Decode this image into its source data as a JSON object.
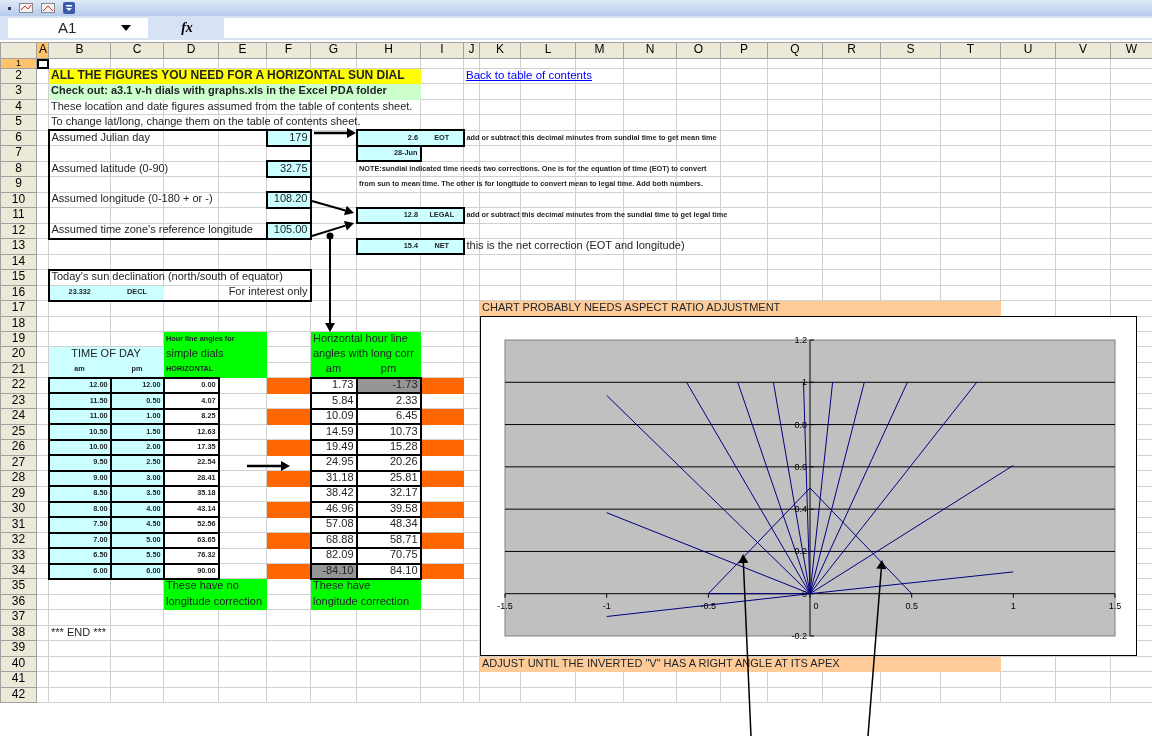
{
  "formula_bar": {
    "name_box": "A1",
    "function_label": "fx"
  },
  "columns": [
    {
      "label": "A",
      "selected": true
    },
    {
      "label": "B",
      "selected": false
    },
    {
      "label": "C",
      "selected": false
    },
    {
      "label": "D",
      "selected": false
    },
    {
      "label": "E",
      "selected": false
    },
    {
      "label": "F",
      "selected": false
    },
    {
      "label": "G",
      "selected": false
    },
    {
      "label": "H",
      "selected": false
    },
    {
      "label": "I",
      "selected": false
    },
    {
      "label": "J",
      "selected": false
    },
    {
      "label": "K",
      "selected": false
    },
    {
      "label": "L",
      "selected": false
    },
    {
      "label": "M",
      "selected": false
    },
    {
      "label": "N",
      "selected": false
    },
    {
      "label": "O",
      "selected": false
    },
    {
      "label": "P",
      "selected": false
    },
    {
      "label": "Q",
      "selected": false
    },
    {
      "label": "R",
      "selected": false
    },
    {
      "label": "S",
      "selected": false
    },
    {
      "label": "T",
      "selected": false
    },
    {
      "label": "U",
      "selected": false
    },
    {
      "label": "V",
      "selected": false
    },
    {
      "label": "W",
      "selected": false
    }
  ],
  "rows": [
    {
      "number": "1",
      "selected": true
    },
    {
      "number": "2",
      "selected": false,
      "cells": {
        "B": {
          "kind": "heading",
          "text": "ALL THE FIGURES YOU NEED FOR A HORIZONTAL SUN DIAL",
          "color": "#ffff00"
        },
        "C": {
          "color": "#ffff00"
        },
        "D": {
          "color": "#ffff00"
        },
        "E": {
          "color": "#ffff00"
        },
        "F": {
          "color": "#ffff00"
        },
        "G": {
          "color": "#ffff00"
        },
        "H": {
          "color": "#ffff00"
        },
        "J": {
          "kind": "link",
          "text": "Back to table of contents"
        }
      }
    },
    {
      "number": "3",
      "selected": false,
      "cells": {
        "B": {
          "kind": "subheading",
          "text": "Check out: a3.1 v-h dials with graphs.xls in the Excel PDA folder",
          "color": "#ccffcc"
        },
        "C": {
          "color": "#ccffcc"
        },
        "D": {
          "color": "#ccffcc"
        },
        "E": {
          "color": "#ccffcc"
        },
        "F": {
          "color": "#ccffcc"
        },
        "G": {
          "color": "#ccffcc"
        },
        "H": {
          "color": "#ccffcc"
        }
      }
    },
    {
      "number": "4",
      "selected": false,
      "cells": {
        "B": {
          "kind": "text",
          "text": "These location and date figures assumed from the table of contents sheet."
        }
      }
    },
    {
      "number": "5",
      "selected": false,
      "cells": {
        "B": {
          "kind": "text",
          "text": "To change lat/long, change them on the table of contents sheet."
        }
      }
    },
    {
      "number": "6",
      "selected": false,
      "cells": {
        "B": {
          "kind": "text",
          "text": "Assumed Julian day"
        },
        "F": {
          "kind": "number",
          "text": "179",
          "color": "#ccffff"
        },
        "H": {
          "kind": "code",
          "text": "2.6",
          "color": "#ccffff"
        },
        "I": {
          "kind": "tag",
          "text": "EOT",
          "color": "#ccffff"
        },
        "J": {
          "kind": "note",
          "text": "add or subtract this decimal minutes from sundial time to get mean time"
        }
      }
    },
    {
      "number": "7",
      "selected": false,
      "cells": {
        "H": {
          "kind": "code",
          "text": "28-Jun",
          "color": "#ccffff"
        }
      }
    },
    {
      "number": "8",
      "selected": false,
      "cells": {
        "B": {
          "kind": "text",
          "text": "Assumed latitude (0-90)"
        },
        "F": {
          "kind": "number",
          "text": "32.75",
          "color": "#ccffff"
        },
        "H": {
          "kind": "note",
          "text": "NOTE:sundial indicated time needs two corrections. One is for the equation of time (EOT) to convert"
        }
      }
    },
    {
      "number": "9",
      "selected": false,
      "cells": {
        "H": {
          "kind": "note",
          "text": "from sun to mean time. The other is for longitude to convert mean to legal time. Add both numbers."
        }
      }
    },
    {
      "number": "10",
      "selected": false,
      "cells": {
        "B": {
          "kind": "text",
          "text": "Assumed longitude (0-180 + or -)"
        },
        "F": {
          "kind": "number",
          "text": "108.20",
          "color": "#ccffff"
        }
      }
    },
    {
      "number": "11",
      "selected": false,
      "cells": {
        "H": {
          "kind": "code",
          "text": "12.8",
          "color": "#ccffff"
        },
        "I": {
          "kind": "tag",
          "text": "LEGAL",
          "color": "#ccffff"
        },
        "J": {
          "kind": "note",
          "text": "add or subtract this decimal minutes from the sundial time to get legal time"
        }
      }
    },
    {
      "number": "12",
      "selected": false,
      "cells": {
        "B": {
          "kind": "text",
          "text": "Assumed time zone's reference longitude"
        },
        "F": {
          "kind": "number",
          "text": "105.00",
          "color": "#ccffff"
        }
      }
    },
    {
      "number": "13",
      "selected": false,
      "cells": {
        "H": {
          "kind": "code",
          "text": "15.4",
          "color": "#ccffff"
        },
        "I": {
          "kind": "tag",
          "text": "NET",
          "color": "#ccffff"
        },
        "J": {
          "kind": "text",
          "text": "this is the net correction (EOT and longitude)"
        }
      }
    },
    {
      "number": "14",
      "selected": false
    },
    {
      "number": "15",
      "selected": false,
      "cells": {
        "B": {
          "kind": "text",
          "text": "Today's sun declination (north/south of equator)"
        }
      }
    },
    {
      "number": "16",
      "selected": false,
      "cells": {
        "B": {
          "kind": "tag",
          "text": "23.332",
          "color": "#ccffff"
        },
        "C": {
          "kind": "tag",
          "text": "DECL",
          "color": "#ccffff"
        },
        "F": {
          "kind": "number",
          "text": "For interest only"
        }
      }
    },
    {
      "number": "17",
      "selected": false,
      "cells": {
        "K": {
          "kind": "banner",
          "text": "CHART PROBABLY NEEDS ASPECT RATIO ADJUSTMENT",
          "color": "#ffcc99"
        },
        "L": {
          "color": "#ffcc99"
        },
        "M": {
          "color": "#ffcc99"
        },
        "N": {
          "color": "#ffcc99"
        },
        "O": {
          "color": "#ffcc99"
        },
        "P": {
          "color": "#ffcc99"
        },
        "Q": {
          "color": "#ffcc99"
        },
        "R": {
          "color": "#ffcc99"
        },
        "S": {
          "color": "#ffcc99"
        },
        "T": {
          "color": "#ffcc99"
        }
      }
    },
    {
      "number": "18",
      "selected": false
    },
    {
      "number": "19",
      "selected": false,
      "cells": {
        "D": {
          "kind": "note",
          "text": "Hour line angles for",
          "color": "#00ff00"
        },
        "E": {
          "color": "#00ff00"
        },
        "G": {
          "kind": "text",
          "text": "Horizontal hour line",
          "color": "#00ff00"
        },
        "H": {
          "color": "#00ff00"
        }
      }
    },
    {
      "number": "20",
      "selected": false,
      "cells": {
        "B": {
          "kind": "label",
          "text": "TIME OF DAY",
          "color": "#ccffff"
        },
        "C": {
          "color": "#ccffff"
        },
        "D": {
          "kind": "text",
          "text": "simple dials",
          "color": "#00ff00"
        },
        "E": {
          "color": "#00ff00"
        },
        "G": {
          "kind": "text",
          "text": "angles with long corr",
          "color": "#00ff00"
        },
        "H": {
          "color": "#00ff00"
        }
      }
    },
    {
      "number": "21",
      "selected": false,
      "cells": {
        "B": {
          "kind": "tag",
          "text": "am",
          "color": "#ccffff"
        },
        "C": {
          "kind": "tag",
          "text": "pm",
          "color": "#ccffff"
        },
        "D": {
          "kind": "note",
          "text": "HORIZONTAL",
          "color": "#00ff00"
        },
        "E": {
          "color": "#00ff00"
        },
        "G": {
          "kind": "label",
          "text": "am",
          "color": "#00ff00"
        },
        "H": {
          "kind": "label",
          "text": "pm",
          "color": "#00ff00"
        }
      }
    },
    {
      "number": "22",
      "selected": false,
      "cells": {
        "B": {
          "kind": "code",
          "text": "12.00",
          "color": "#ccffff"
        },
        "C": {
          "kind": "code",
          "text": "12.00",
          "color": "#ccffff"
        },
        "D": {
          "kind": "code",
          "text": "0.00"
        },
        "F": {
          "color": "#ff6600"
        },
        "G": {
          "kind": "number",
          "text": "1.73"
        },
        "H": {
          "kind": "number",
          "text": "-1.73",
          "color": "#969696"
        },
        "I": {
          "color": "#ff6600"
        }
      }
    },
    {
      "number": "23",
      "selected": false,
      "cells": {
        "B": {
          "kind": "code",
          "text": "11.50",
          "color": "#ccffff"
        },
        "C": {
          "kind": "code",
          "text": "0.50",
          "color": "#ccffff"
        },
        "D": {
          "kind": "code",
          "text": "4.07"
        },
        "G": {
          "kind": "number",
          "text": "5.84"
        },
        "H": {
          "kind": "number",
          "text": "2.33"
        }
      }
    },
    {
      "number": "24",
      "selected": false,
      "cells": {
        "B": {
          "kind": "code",
          "text": "11.00",
          "color": "#ccffff"
        },
        "C": {
          "kind": "code",
          "text": "1.00",
          "color": "#ccffff"
        },
        "D": {
          "kind": "code",
          "text": "8.25"
        },
        "F": {
          "color": "#ff6600"
        },
        "G": {
          "kind": "number",
          "text": "10.09"
        },
        "H": {
          "kind": "number",
          "text": "6.45"
        },
        "I": {
          "color": "#ff6600"
        }
      }
    },
    {
      "number": "25",
      "selected": false,
      "cells": {
        "B": {
          "kind": "code",
          "text": "10.50",
          "color": "#ccffff"
        },
        "C": {
          "kind": "code",
          "text": "1.50",
          "color": "#ccffff"
        },
        "D": {
          "kind": "code",
          "text": "12.63"
        },
        "G": {
          "kind": "number",
          "text": "14.59"
        },
        "H": {
          "kind": "number",
          "text": "10.73"
        }
      }
    },
    {
      "number": "26",
      "selected": false,
      "cells": {
        "B": {
          "kind": "code",
          "text": "10.00",
          "color": "#ccffff"
        },
        "C": {
          "kind": "code",
          "text": "2.00",
          "color": "#ccffff"
        },
        "D": {
          "kind": "code",
          "text": "17.35"
        },
        "F": {
          "color": "#ff6600"
        },
        "G": {
          "kind": "number",
          "text": "19.49"
        },
        "H": {
          "kind": "number",
          "text": "15.28"
        },
        "I": {
          "color": "#ff6600"
        }
      }
    },
    {
      "number": "27",
      "selected": false,
      "cells": {
        "B": {
          "kind": "code",
          "text": "9.50",
          "color": "#ccffff"
        },
        "C": {
          "kind": "code",
          "text": "2.50",
          "color": "#ccffff"
        },
        "D": {
          "kind": "code",
          "text": "22.54"
        },
        "G": {
          "kind": "number",
          "text": "24.95"
        },
        "H": {
          "kind": "number",
          "text": "20.26"
        }
      }
    },
    {
      "number": "28",
      "selected": false,
      "cells": {
        "B": {
          "kind": "code",
          "text": "9.00",
          "color": "#ccffff"
        },
        "C": {
          "kind": "code",
          "text": "3.00",
          "color": "#ccffff"
        },
        "D": {
          "kind": "code",
          "text": "28.41"
        },
        "F": {
          "color": "#ff6600"
        },
        "G": {
          "kind": "number",
          "text": "31.18"
        },
        "H": {
          "kind": "number",
          "text": "25.81"
        },
        "I": {
          "color": "#ff6600"
        }
      }
    },
    {
      "number": "29",
      "selected": false,
      "cells": {
        "B": {
          "kind": "code",
          "text": "8.50",
          "color": "#ccffff"
        },
        "C": {
          "kind": "code",
          "text": "3.50",
          "color": "#ccffff"
        },
        "D": {
          "kind": "code",
          "text": "35.18"
        },
        "G": {
          "kind": "number",
          "text": "38.42"
        },
        "H": {
          "kind": "number",
          "text": "32.17"
        }
      }
    },
    {
      "number": "30",
      "selected": false,
      "cells": {
        "B": {
          "kind": "code",
          "text": "8.00",
          "color": "#ccffff"
        },
        "C": {
          "kind": "code",
          "text": "4.00",
          "color": "#ccffff"
        },
        "D": {
          "kind": "code",
          "text": "43.14"
        },
        "F": {
          "color": "#ff6600"
        },
        "G": {
          "kind": "number",
          "text": "46.96"
        },
        "H": {
          "kind": "number",
          "text": "39.58"
        },
        "I": {
          "color": "#ff6600"
        }
      }
    },
    {
      "number": "31",
      "selected": false,
      "cells": {
        "B": {
          "kind": "code",
          "text": "7.50",
          "color": "#ccffff"
        },
        "C": {
          "kind": "code",
          "text": "4.50",
          "color": "#ccffff"
        },
        "D": {
          "kind": "code",
          "text": "52.56"
        },
        "G": {
          "kind": "number",
          "text": "57.08"
        },
        "H": {
          "kind": "number",
          "text": "48.34"
        }
      }
    },
    {
      "number": "32",
      "selected": false,
      "cells": {
        "B": {
          "kind": "code",
          "text": "7.00",
          "color": "#ccffff"
        },
        "C": {
          "kind": "code",
          "text": "5.00",
          "color": "#ccffff"
        },
        "D": {
          "kind": "code",
          "text": "63.65"
        },
        "F": {
          "color": "#ff6600"
        },
        "G": {
          "kind": "number",
          "text": "68.88"
        },
        "H": {
          "kind": "number",
          "text": "58.71"
        },
        "I": {
          "color": "#ff6600"
        }
      }
    },
    {
      "number": "33",
      "selected": false,
      "cells": {
        "B": {
          "kind": "code",
          "text": "6.50",
          "color": "#ccffff"
        },
        "C": {
          "kind": "code",
          "text": "5.50",
          "color": "#ccffff"
        },
        "D": {
          "kind": "code",
          "text": "76.32"
        },
        "G": {
          "kind": "number",
          "text": "82.09"
        },
        "H": {
          "kind": "number",
          "text": "70.75"
        }
      }
    },
    {
      "number": "34",
      "selected": false,
      "cells": {
        "B": {
          "kind": "code",
          "text": "6.00",
          "color": "#ccffff"
        },
        "C": {
          "kind": "code",
          "text": "6.00",
          "color": "#ccffff"
        },
        "D": {
          "kind": "code",
          "text": "90.00"
        },
        "F": {
          "color": "#ff6600"
        },
        "G": {
          "kind": "number",
          "text": "-84.10",
          "color": "#969696"
        },
        "H": {
          "kind": "number",
          "text": "84.10"
        },
        "I": {
          "color": "#ff6600"
        }
      }
    },
    {
      "number": "35",
      "selected": false,
      "cells": {
        "D": {
          "kind": "text",
          "text": "These have no",
          "color": "#00ff00"
        },
        "E": {
          "color": "#00ff00"
        },
        "G": {
          "kind": "text",
          "text": "These have",
          "color": "#00ff00"
        },
        "H": {
          "color": "#00ff00"
        }
      }
    },
    {
      "number": "36",
      "selected": false,
      "cells": {
        "D": {
          "kind": "text",
          "text": "longitude correction",
          "color": "#00ff00"
        },
        "E": {
          "color": "#00ff00"
        },
        "G": {
          "kind": "text",
          "text": "longitude correction",
          "color": "#00ff00"
        },
        "H": {
          "color": "#00ff00"
        }
      }
    },
    {
      "number": "37",
      "selected": false
    },
    {
      "number": "38",
      "selected": false,
      "cells": {
        "B": {
          "kind": "text",
          "text": "*** END ***"
        }
      }
    },
    {
      "number": "39",
      "selected": false
    },
    {
      "number": "40",
      "selected": false,
      "cells": {
        "K": {
          "kind": "banner",
          "text": "ADJUST UNTIL THE INVERTED \"V\" HAS A RIGHT ANGLE AT ITS APEX",
          "color": "#ffcc99"
        },
        "L": {
          "color": "#ffcc99"
        },
        "M": {
          "color": "#ffcc99"
        },
        "N": {
          "color": "#ffcc99"
        },
        "O": {
          "color": "#ffcc99"
        },
        "P": {
          "color": "#ffcc99"
        },
        "Q": {
          "color": "#ffcc99"
        },
        "R": {
          "color": "#ffcc99"
        },
        "S": {
          "color": "#ffcc99"
        },
        "T": {
          "color": "#ffcc99"
        }
      }
    },
    {
      "number": "41",
      "selected": false
    },
    {
      "number": "42",
      "selected": false
    }
  ],
  "chart": {
    "chart_data": {
      "type": "line",
      "grid": true,
      "xlim": [
        -1.5,
        1.5
      ],
      "ylim": [
        -0.2,
        1.2
      ],
      "xticks": [
        {
          "value": -1.5,
          "label": "-1.5"
        },
        {
          "value": -1,
          "label": "-1"
        },
        {
          "value": -0.5,
          "label": "-0.5"
        },
        {
          "value": 0,
          "label": "0"
        },
        {
          "value": 0.5,
          "label": "0.5"
        },
        {
          "value": 1,
          "label": "1"
        },
        {
          "value": 1.5,
          "label": "1.5"
        }
      ],
      "yticks": [
        {
          "value": -0.2,
          "label": "-0.2"
        },
        {
          "value": 0,
          "label": "0"
        },
        {
          "value": 0.2,
          "label": "0.2"
        },
        {
          "value": 0.4,
          "label": "0.4"
        },
        {
          "value": 0.6,
          "label": "0.6"
        },
        {
          "value": 0.8,
          "label": "0.8"
        },
        {
          "value": 1,
          "label": "1"
        },
        {
          "value": 1.2,
          "label": "1.2"
        }
      ],
      "series": [
        {
          "color": "#000080",
          "x": [
            0,
            -0.607
          ],
          "values": [
            0,
            1
          ]
        },
        {
          "color": "#000080",
          "x": [
            0,
            -0.355
          ],
          "values": [
            0,
            1
          ]
        },
        {
          "color": "#000080",
          "x": [
            0,
            -0.18
          ],
          "values": [
            0,
            1
          ]
        },
        {
          "color": "#000080",
          "x": [
            0,
            -0.032
          ],
          "values": [
            0,
            1
          ]
        },
        {
          "color": "#000080",
          "x": [
            0,
            0.111
          ],
          "values": [
            0,
            1
          ]
        },
        {
          "color": "#000080",
          "x": [
            0,
            0.267
          ],
          "values": [
            0,
            1
          ]
        },
        {
          "color": "#000080",
          "x": [
            0,
            0.479
          ],
          "values": [
            0,
            1
          ]
        },
        {
          "color": "#000080",
          "x": [
            0,
            0.82
          ],
          "values": [
            0,
            1
          ]
        },
        {
          "color": "#000080",
          "x": [
            0,
            -1
          ],
          "values": [
            0,
            0.938
          ]
        },
        {
          "color": "#000080",
          "x": [
            0,
            -1
          ],
          "values": [
            0,
            0.383
          ]
        },
        {
          "color": "#000080",
          "x": [
            -1,
            0,
            1
          ],
          "values": [
            -0.108,
            0,
            0.103
          ]
        },
        {
          "color": "#000080",
          "x": [
            0,
            1
          ],
          "values": [
            0,
            0.607
          ]
        },
        {
          "color": "#000080",
          "x": [
            -0.5,
            0,
            0.5
          ],
          "values": [
            0,
            0.5,
            0
          ]
        },
        {
          "color": "#000080",
          "x": [
            -0.5,
            0
          ],
          "values": [
            0,
            0
          ]
        }
      ]
    }
  }
}
